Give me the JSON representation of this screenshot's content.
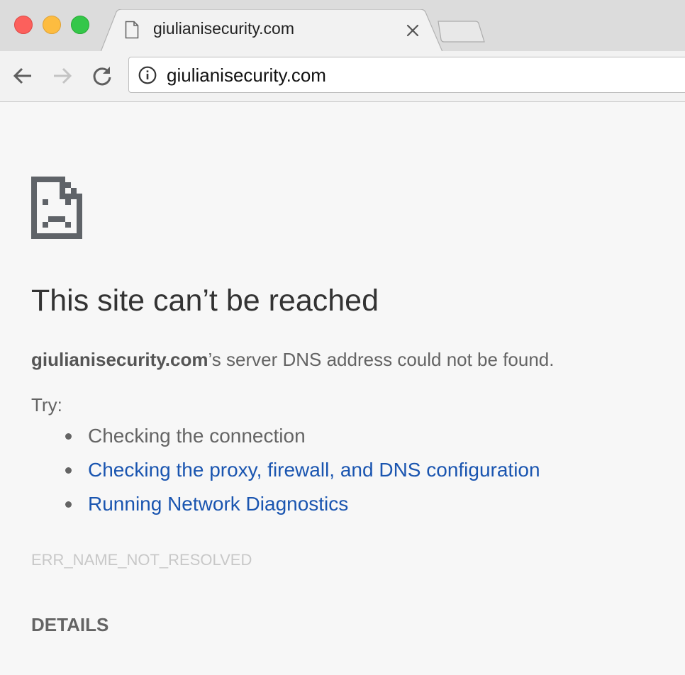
{
  "window": {
    "traffic_lights": {
      "close_color": "#fc605c",
      "minimize_color": "#fdbc40",
      "zoom_color": "#34c749"
    }
  },
  "tab": {
    "title": "giulianisecurity.com",
    "icon": "page-icon",
    "close_icon": "close-icon"
  },
  "toolbar": {
    "back_icon": "arrow-left-icon",
    "forward_icon": "arrow-right-icon",
    "reload_icon": "reload-icon",
    "omnibox": {
      "icon": "info-icon",
      "url": "giulianisecurity.com"
    }
  },
  "error_page": {
    "icon": "sad-document-icon",
    "heading": "This site can’t be reached",
    "summary_domain": "giulianisecurity.com",
    "summary_rest": "’s server DNS address could not be found.",
    "try_label": "Try:",
    "suggestions": [
      {
        "text": "Checking the connection",
        "is_link": false
      },
      {
        "text": "Checking the proxy, firewall, and DNS configuration",
        "is_link": true
      },
      {
        "text": "Running Network Diagnostics",
        "is_link": true
      }
    ],
    "error_code": "ERR_NAME_NOT_RESOLVED",
    "details_label": "DETAILS"
  },
  "colors": {
    "link": "#1a55b0",
    "body_text": "#646464",
    "page_background": "#f7f7f7"
  }
}
